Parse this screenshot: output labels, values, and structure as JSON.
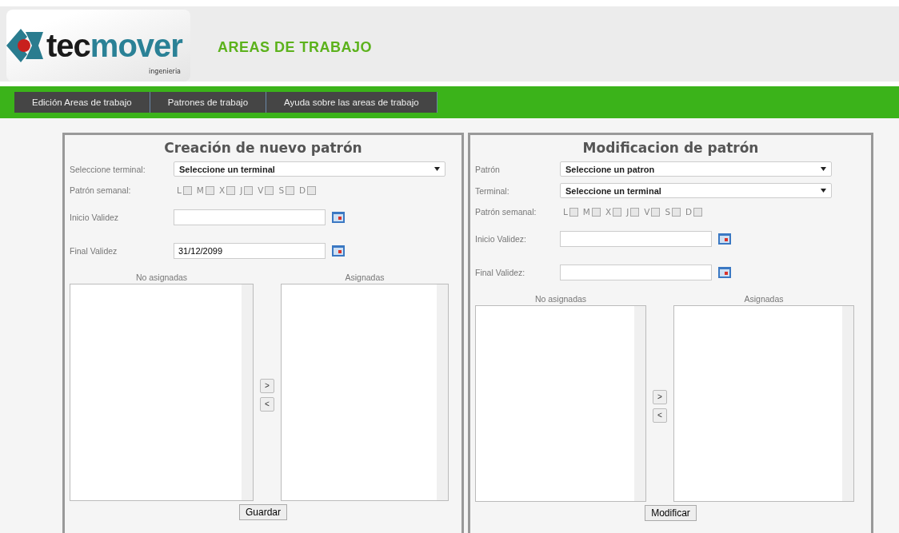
{
  "header": {
    "logo": {
      "part_1": "tec",
      "part_2": "mover",
      "tagline": "ingenieria"
    },
    "title": "AREAS DE TRABAJO"
  },
  "menu": [
    {
      "label": "Edición Areas de trabajo"
    },
    {
      "label": "Patrones de trabajo"
    },
    {
      "label": "Ayuda sobre las areas de trabajo"
    }
  ],
  "panels": [
    {
      "title": "Creación de nuevo patrón",
      "fields": [
        {
          "kind": "select",
          "label": "Seleccione terminal:",
          "value": "Seleccione un terminal"
        },
        {
          "kind": "days",
          "label": "Patrón semanal:",
          "days": [
            {
              "label": "L",
              "checked": false
            },
            {
              "label": "M",
              "checked": false
            },
            {
              "label": "X",
              "checked": false
            },
            {
              "label": "J",
              "checked": false
            },
            {
              "label": "V",
              "checked": false
            },
            {
              "label": "S",
              "checked": false
            },
            {
              "label": "D",
              "checked": false
            }
          ]
        },
        {
          "kind": "date",
          "label": "Inicio Validez"
        },
        {
          "kind": "date",
          "label": "Final Validez",
          "value": "31/12/2099"
        }
      ],
      "lists": [
        "No asignadas",
        "Asignadas"
      ],
      "move_buttons": [
        ">",
        "<"
      ],
      "action": "Guardar"
    },
    {
      "title": "Modificacion de patrón",
      "fields": [
        {
          "kind": "select",
          "label": "Patrón",
          "value": "Seleccione un patron"
        },
        {
          "kind": "select",
          "label": "Terminal:",
          "value": "Seleccione un terminal"
        },
        {
          "kind": "days",
          "label": "Patrón semanal:",
          "days": [
            {
              "label": "L",
              "checked": false
            },
            {
              "label": "M",
              "checked": false
            },
            {
              "label": "X",
              "checked": false
            },
            {
              "label": "J",
              "checked": false
            },
            {
              "label": "V",
              "checked": false
            },
            {
              "label": "S",
              "checked": false
            },
            {
              "label": "D",
              "checked": false
            }
          ]
        },
        {
          "kind": "date",
          "label": "Inicio Validez:"
        },
        {
          "kind": "date",
          "label": "Final Validez:"
        }
      ],
      "lists": [
        "No asignadas",
        "Asignadas"
      ],
      "move_buttons": [
        ">",
        "<"
      ],
      "action": "Modificar"
    }
  ]
}
